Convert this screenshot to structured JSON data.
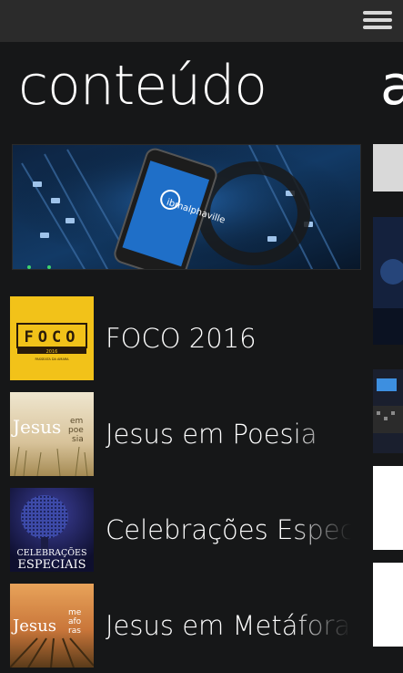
{
  "app": {
    "section_title": "conteúdo",
    "next_section_title": "a",
    "menu_icon": "hamburger-menu-icon"
  },
  "hero": {
    "image": "mixing-console-phone-banner",
    "phone_text": "ibmalphaville"
  },
  "items": [
    {
      "label": "FOCO 2016",
      "thumb_text": "FOCO",
      "thumb_subtext": "2016",
      "thumb_caption": "PASSEATA DA AMARA",
      "thumb_color": "#f2c219"
    },
    {
      "label": "Jesus em Poesia",
      "thumb_text": "Jesus",
      "thumb_side_1": "em",
      "thumb_side_2": "poe",
      "thumb_side_3": "sia"
    },
    {
      "label": "Celebrações Especiais",
      "thumb_text_1": "CELEBRAÇÕES",
      "thumb_text_2": "ESPECIAIS"
    },
    {
      "label": "Jesus em Metáforas",
      "thumb_text": "Jesus",
      "thumb_side_1": "me",
      "thumb_side_2": "afo",
      "thumb_side_3": "ras"
    }
  ],
  "colors": {
    "background": "#161718",
    "topbar": "#2b2b2b",
    "foco_yellow": "#f2c219"
  }
}
